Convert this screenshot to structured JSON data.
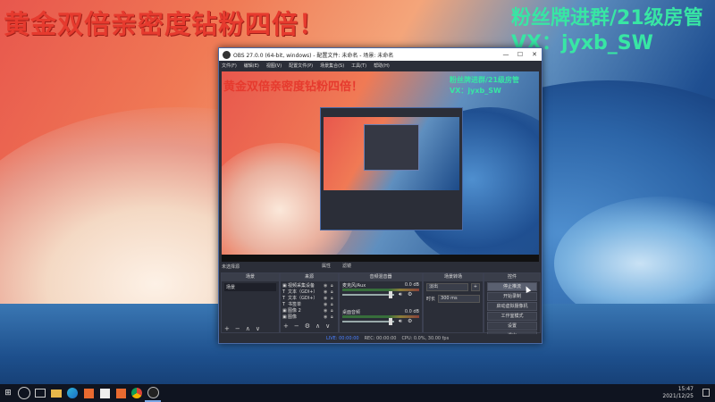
{
  "desktop": {
    "overlay_red": "黄金双倍亲密度钻粉四倍！",
    "overlay_green_line1": "粉丝牌进群/21级房管",
    "overlay_green_line2": "VX：jyxb_SW"
  },
  "obs": {
    "title": "OBS 27.0.0 (64-bit, windows) - 配置文件: 未命名 - 场景: 未命名",
    "window_controls": {
      "minimize": "—",
      "maximize": "☐",
      "close": "✕"
    },
    "menu": [
      "文件(F)",
      "编辑(E)",
      "视图(V)",
      "配置文件(P)",
      "场景集合(S)",
      "工具(T)",
      "帮助(H)"
    ],
    "preview": {
      "red_text": "黄金双倍亲密度钻粉四倍！",
      "green_line1": "粉丝牌进群/21级房管",
      "green_line2": "VX：jyxb_SW"
    },
    "docks_header": {
      "scene_label": "未选择源",
      "props_label": "属性",
      "filters_label": "滤镜"
    },
    "scenes": {
      "title": "场景",
      "items": [
        "场景"
      ],
      "tools": [
        "+",
        "−",
        "∧",
        "∨"
      ]
    },
    "sources": {
      "title": "来源",
      "items": [
        {
          "icon": "▣",
          "name": "视频采集设备"
        },
        {
          "icon": "T",
          "name": "文本（GDI+）"
        },
        {
          "icon": "T",
          "name": "文本（GDI+）"
        },
        {
          "icon": "T",
          "name": "书签单"
        },
        {
          "icon": "▣",
          "name": "图像 2"
        },
        {
          "icon": "▣",
          "name": "图像"
        }
      ],
      "tools": [
        "+",
        "−",
        "⚙",
        "∧",
        "∨"
      ]
    },
    "mixer": {
      "title": "音频混音器",
      "channels": [
        {
          "name": "麦克风/Aux",
          "db": "0.0 dB"
        },
        {
          "name": "桌面音频",
          "db": "0.0 dB"
        }
      ]
    },
    "transitions": {
      "title": "场景转场",
      "type": "淡出",
      "duration_label": "时长",
      "duration_value": "300 ms"
    },
    "controls": {
      "title": "控件",
      "buttons": [
        "停止推流",
        "开始录制",
        "启动虚拟摄像机",
        "工作室模式",
        "设置",
        "退出"
      ]
    },
    "status": {
      "live": "LIVE: 00:00:00",
      "rec": "REC: 00:00:00",
      "cpu": "CPU: 0.0%, 30.00 fps"
    }
  },
  "taskbar": {
    "start_icon": "⊞",
    "clock_time": "15:47",
    "clock_date": "2021/12/25"
  }
}
